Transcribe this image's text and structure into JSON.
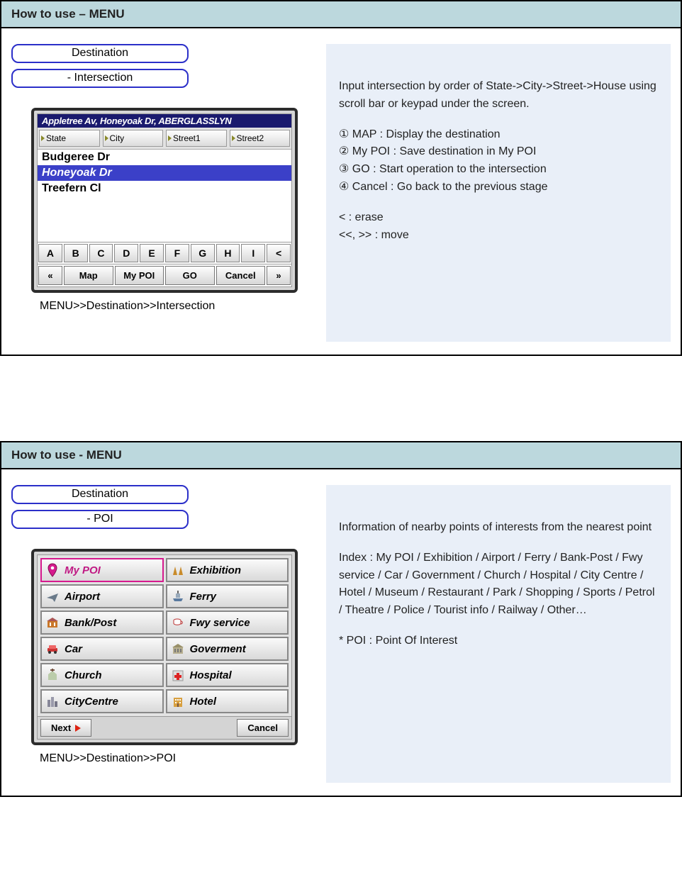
{
  "section1": {
    "title": "How to use – MENU",
    "pills": {
      "destination": "Destination",
      "sub": "- Intersection"
    },
    "device": {
      "topbar": "Appletree Av, Honeyoak Dr, ABERGLASSLYN",
      "tabs": [
        "State",
        "City",
        "Street1",
        "Street2"
      ],
      "list": [
        "Budgeree Dr",
        "Honeyoak Dr",
        "Treefern Cl"
      ],
      "keys": [
        "A",
        "B",
        "C",
        "D",
        "E",
        "F",
        "G",
        "H",
        "I",
        "<"
      ],
      "bottom": {
        "prev": "«",
        "map": "Map",
        "mypoi": "My POI",
        "go": "GO",
        "cancel": "Cancel",
        "next": "»"
      }
    },
    "caption": "MENU>>Destination>>Intersection",
    "desc": {
      "intro": "Input intersection by order of State->City->Street->House using scroll bar or keypad under the screen.",
      "items": [
        "① MAP : Display the destination",
        "② My POI : Save destination in My POI",
        "③ GO : Start operation to the intersection",
        "④ Cancel : Go back to the previous stage"
      ],
      "hint1": "< : erase",
      "hint2": "<<, >> : move"
    }
  },
  "section2": {
    "title": "How to use - MENU",
    "pills": {
      "destination": "Destination",
      "sub": "- POI"
    },
    "device": {
      "poi": [
        {
          "label": "My POI",
          "selected": true,
          "icon": "pin"
        },
        {
          "label": "Exhibition",
          "icon": "exhib"
        },
        {
          "label": "Airport",
          "icon": "plane"
        },
        {
          "label": "Ferry",
          "icon": "ferry"
        },
        {
          "label": "Bank/Post",
          "icon": "bank"
        },
        {
          "label": "Fwy service",
          "icon": "cup"
        },
        {
          "label": "Car",
          "icon": "car"
        },
        {
          "label": "Goverment",
          "icon": "gov"
        },
        {
          "label": "Church",
          "icon": "church"
        },
        {
          "label": "Hospital",
          "icon": "hospital"
        },
        {
          "label": "CityCentre",
          "icon": "city"
        },
        {
          "label": "Hotel",
          "icon": "hotel"
        }
      ],
      "footer": {
        "next": "Next",
        "cancel": "Cancel"
      }
    },
    "caption": "MENU>>Destination>>POI",
    "desc": {
      "intro": "Information of nearby points of interests from the nearest point",
      "index": "Index : My POI / Exhibition / Airport / Ferry / Bank-Post / Fwy service / Car / Government / Church / Hospital / City Centre / Hotel / Museum / Restaurant / Park / Shopping / Sports / Petrol / Theatre / Police / Tourist info / Railway / Other…",
      "note": "* POI : Point Of Interest"
    }
  }
}
